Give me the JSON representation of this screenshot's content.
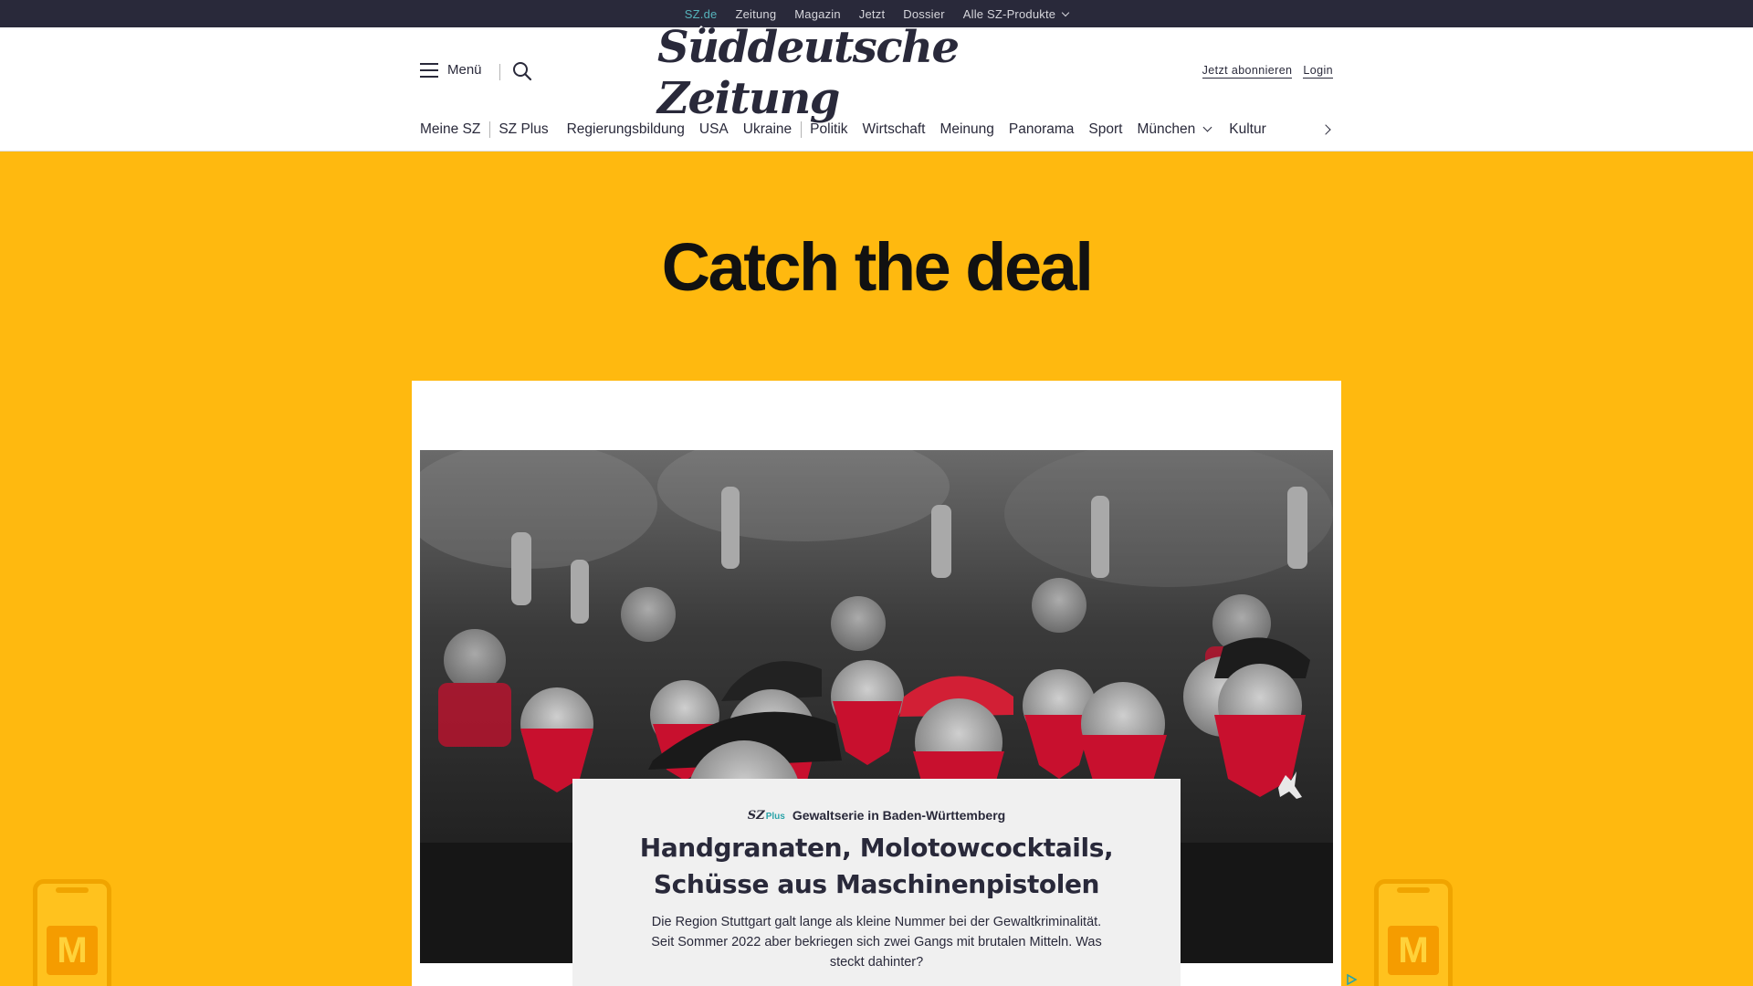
{
  "topbar": {
    "links": [
      "SZ.de",
      "Zeitung",
      "Magazin",
      "Jetzt",
      "Dossier",
      "Alle SZ-Produkte"
    ]
  },
  "header": {
    "menu_label": "Menü",
    "logo_text": "Süddeutsche Zeitung",
    "subscribe_label": "Jetzt abonnieren",
    "login_label": "Login"
  },
  "nav": {
    "items": [
      "Meine SZ",
      "SZ Plus",
      "Regierungsbildung",
      "USA",
      "Ukraine",
      "Politik",
      "Wirtschaft",
      "Meinung",
      "Panorama",
      "Sport",
      "München",
      "Kultur"
    ]
  },
  "ad": {
    "headline": "Catch the deal",
    "brand_glyph": "M"
  },
  "article": {
    "badge_sz": "SZ",
    "badge_plus": "Plus",
    "kicker": "Gewaltserie in Baden-Württemberg",
    "headline": "Handgranaten, Molotowcocktails, Schüsse aus Maschinenpistolen",
    "teaser": "Die Region Stuttgart galt lange als kleine Nummer bei der Gewaltkriminalität. Seit Sommer 2022 aber bekriegen sich zwei Gangs mit brutalen Mitteln. Was steckt dahinter?"
  },
  "colors": {
    "ad_background": "#ffb90f",
    "topbar": "#29293a",
    "accent_teal": "#56b3bb",
    "bandana_red": "#c8102e"
  }
}
